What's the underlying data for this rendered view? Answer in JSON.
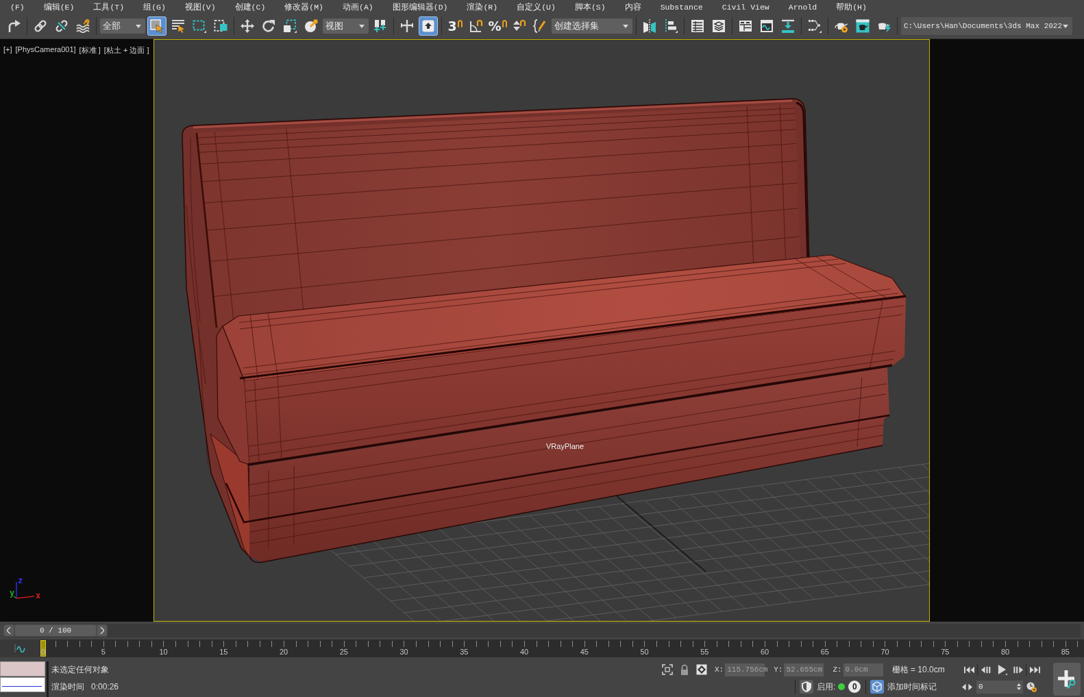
{
  "menu_bar": {
    "items": [
      "(F)",
      "编辑(E)",
      "工具(T)",
      "组(G)",
      "视图(V)",
      "创建(C)",
      "修改器(M)",
      "动画(A)",
      "图形编辑器(D)",
      "渲染(R)",
      "自定义(U)",
      "脚本(S)",
      "内容",
      "Substance",
      "Civil View",
      "Arnold",
      "帮助(H)"
    ]
  },
  "toolbar": {
    "groups": [
      {
        "items": [
          {
            "kind": "button",
            "selected": false
          }
        ]
      },
      {
        "items": [
          {
            "kind": "button",
            "selected": false
          },
          {
            "kind": "button",
            "selected": false
          },
          {
            "kind": "button",
            "selected": false
          }
        ]
      },
      {
        "items": [
          {
            "kind": "dropdown",
            "value": "全部"
          },
          {
            "kind": "button",
            "selected": true
          },
          {
            "kind": "button",
            "selected": false
          },
          {
            "kind": "button",
            "selected": false
          },
          {
            "kind": "button",
            "selected": false
          }
        ]
      },
      {
        "items": [
          {
            "kind": "button",
            "selected": false
          },
          {
            "kind": "button",
            "selected": false
          },
          {
            "kind": "button",
            "selected": false
          },
          {
            "kind": "button",
            "selected": false
          },
          {
            "kind": "dropdown",
            "value": "视图"
          },
          {
            "kind": "button",
            "selected": false
          }
        ]
      },
      {
        "items": [
          {
            "kind": "button",
            "selected": false
          },
          {
            "kind": "button",
            "selected": true
          }
        ]
      },
      {
        "items": [
          {
            "kind": "button",
            "selected": false,
            "text": "3"
          },
          {
            "kind": "button",
            "selected": false
          },
          {
            "kind": "button",
            "selected": false,
            "text": "%"
          },
          {
            "kind": "button",
            "selected": false
          },
          {
            "kind": "button",
            "selected": false
          },
          {
            "kind": "dropdown",
            "value": "创建选择集"
          }
        ]
      },
      {
        "items": [
          {
            "kind": "button",
            "selected": false
          },
          {
            "kind": "button",
            "selected": false
          }
        ]
      },
      {
        "items": [
          {
            "kind": "button",
            "selected": false
          },
          {
            "kind": "button",
            "selected": false
          }
        ]
      },
      {
        "items": [
          {
            "kind": "button",
            "selected": false
          },
          {
            "kind": "button",
            "selected": false
          },
          {
            "kind": "button",
            "selected": false
          }
        ]
      },
      {
        "items": [
          {
            "kind": "button",
            "selected": false
          }
        ]
      },
      {
        "items": [
          {
            "kind": "button",
            "selected": false
          },
          {
            "kind": "button",
            "selected": false
          },
          {
            "kind": "button",
            "selected": false
          }
        ]
      },
      {
        "items": [
          {
            "kind": "dropdown",
            "value": "C:\\Users\\Han\\Documents\\3ds Max 2022"
          }
        ]
      }
    ]
  },
  "viewport": {
    "labels": [
      "[+]",
      "[PhysCamera001]",
      "[标准 ]",
      "[粘土 + 边面 ]"
    ],
    "object_label": "VRayPlane",
    "axis_gizmo": {
      "z": "z",
      "y": "y",
      "x": "x"
    }
  },
  "time_slider": {
    "label": "0 / 100",
    "level": 0
  },
  "track_bar": {
    "labels": [
      "0",
      "5",
      "10",
      "15",
      "20",
      "25",
      "30",
      "35",
      "40",
      "45",
      "50",
      "55",
      "60",
      "65",
      "70",
      "75",
      "80",
      "85"
    ]
  },
  "status_bar": {
    "prompt": "未选定任何对象",
    "render_time_label": "渲染时间",
    "render_time": "0:00:26",
    "coordinates": [
      {
        "label": "X:",
        "value": "115.756cm",
        "disabled": true
      },
      {
        "label": "Y:",
        "value": "52.655cm",
        "disabled": true
      },
      {
        "label": "Z:",
        "value": "0.0cm",
        "disabled": true
      }
    ],
    "grid": "栅格 = 10.0cm",
    "enable_label": "启用:",
    "enabled": true,
    "counter": "0",
    "time_tag_button": "添加时间标记",
    "frame": "0"
  }
}
